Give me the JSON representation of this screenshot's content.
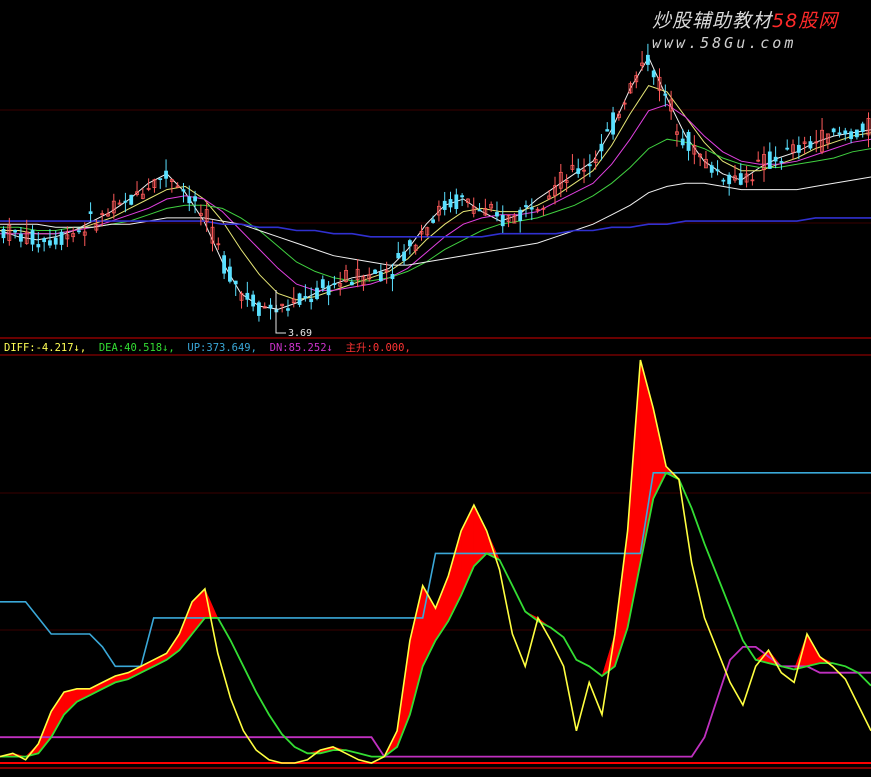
{
  "watermark": {
    "title_main": "炒股辅助教材",
    "title_brand": "58股网",
    "url": "www.58Gu.com"
  },
  "price_panel": {
    "min_label": "3.69"
  },
  "indicator_legend": [
    {
      "label": "DIFF:",
      "value": "-4.217",
      "arrow": "↓",
      "color": "#ffff55"
    },
    {
      "label": "DEA:",
      "value": "40.518",
      "arrow": "↓",
      "color": "#33dd33"
    },
    {
      "label": "UP:",
      "value": "373.649",
      "arrow": "",
      "color": "#3aa8d8"
    },
    {
      "label": "DN:",
      "value": "85.252",
      "arrow": "↓",
      "color": "#cc33cc"
    },
    {
      "label": "主升:",
      "value": "0.000",
      "arrow": "",
      "color": "#ff3333"
    }
  ],
  "colors": {
    "background": "#000000",
    "up_candle": "#ff5a5a",
    "down_candle": "#5ae0ff",
    "ma_white": "#f0f0f0",
    "ma_yellow": "#e6e676",
    "ma_magenta": "#e040e0",
    "ma_green": "#40d040",
    "ma_blue": "#3030d0",
    "diff": "#ffff40",
    "dea": "#33dd33",
    "up": "#3aa8d8",
    "dn": "#c030c0",
    "fill": "#ff0000",
    "separator": "#aa0000",
    "grid": "#3a0000"
  },
  "chart_data": [
    {
      "type": "line",
      "title": "",
      "annotations": [
        "3.69"
      ],
      "series": [
        {
          "values": [
            30,
            28,
            27,
            28,
            30,
            33,
            36,
            40,
            45,
            48,
            42,
            33,
            20,
            10,
            6,
            5,
            7,
            10,
            13,
            15,
            16,
            18,
            24,
            32,
            38,
            40,
            36,
            33,
            35,
            40,
            44,
            48,
            52,
            62,
            75,
            85,
            72,
            60,
            52,
            48,
            46,
            50,
            53,
            55,
            58,
            60,
            61,
            62
          ]
        },
        {
          "values": [
            30,
            30,
            29,
            29,
            30,
            32,
            34,
            37,
            40,
            43,
            44,
            40,
            33,
            24,
            16,
            10,
            8,
            9,
            11,
            13,
            15,
            17,
            21,
            27,
            32,
            36,
            37,
            36,
            36,
            38,
            41,
            45,
            49,
            57,
            67,
            76,
            74,
            66,
            58,
            52,
            49,
            49,
            51,
            53,
            56,
            58,
            60,
            61
          ]
        },
        {
          "values": [
            29,
            29,
            29,
            29,
            30,
            31,
            33,
            35,
            37,
            40,
            41,
            40,
            36,
            30,
            24,
            18,
            13,
            11,
            11,
            12,
            13,
            15,
            18,
            23,
            28,
            32,
            34,
            35,
            35,
            36,
            39,
            42,
            45,
            51,
            59,
            68,
            70,
            66,
            60,
            55,
            52,
            51,
            51,
            52,
            54,
            56,
            58,
            59
          ]
        },
        {
          "values": [
            31,
            31,
            30,
            30,
            31,
            31,
            32,
            33,
            35,
            37,
            38,
            38,
            37,
            34,
            30,
            25,
            20,
            17,
            15,
            14,
            14,
            15,
            17,
            20,
            24,
            27,
            30,
            32,
            33,
            34,
            36,
            38,
            41,
            45,
            50,
            56,
            59,
            58,
            56,
            53,
            51,
            50,
            50,
            51,
            52,
            53,
            55,
            56
          ]
        },
        {
          "values": [
            32,
            32,
            32,
            31,
            31,
            31,
            32,
            32,
            33,
            34,
            34,
            34,
            33,
            32,
            30,
            28,
            26,
            24,
            22,
            21,
            20,
            19,
            19,
            20,
            21,
            22,
            23,
            24,
            25,
            26,
            28,
            30,
            32,
            35,
            38,
            42,
            44,
            45,
            45,
            44,
            43,
            43,
            43,
            43,
            44,
            45,
            46,
            47
          ]
        },
        {
          "values": [
            33,
            33,
            33,
            33,
            33,
            33,
            33,
            33,
            33,
            33,
            33,
            33,
            32,
            32,
            31,
            31,
            30,
            30,
            29,
            29,
            28,
            28,
            28,
            28,
            28,
            28,
            28,
            29,
            29,
            29,
            29,
            30,
            30,
            31,
            31,
            32,
            32,
            33,
            33,
            33,
            33,
            33,
            33,
            33,
            34,
            34,
            34,
            34
          ]
        }
      ]
    },
    {
      "type": "area",
      "title": "",
      "series": [
        {
          "name": "DIFF",
          "values": [
            2,
            3,
            1,
            6,
            16,
            22,
            23,
            23,
            25,
            27,
            28,
            30,
            32,
            34,
            40,
            50,
            54,
            34,
            20,
            10,
            4,
            1,
            0,
            0,
            1,
            4,
            5,
            3,
            1,
            0,
            2,
            10,
            38,
            55,
            48,
            58,
            72,
            80,
            72,
            60,
            40,
            30,
            45,
            38,
            30,
            10,
            25,
            15,
            40,
            72,
            125,
            110,
            92,
            88,
            62,
            45,
            35,
            25,
            18,
            30,
            35,
            28,
            25,
            40,
            33,
            30,
            26,
            18,
            10
          ]
        },
        {
          "name": "DEA",
          "values": [
            2,
            2,
            2,
            3,
            8,
            15,
            19,
            21,
            23,
            25,
            26,
            28,
            30,
            32,
            35,
            40,
            45,
            45,
            38,
            30,
            22,
            15,
            9,
            5,
            3,
            3,
            4,
            4,
            3,
            2,
            2,
            5,
            15,
            30,
            38,
            44,
            52,
            61,
            65,
            63,
            55,
            47,
            44,
            42,
            39,
            32,
            30,
            27,
            30,
            42,
            62,
            82,
            90,
            88,
            79,
            68,
            58,
            48,
            38,
            32,
            31,
            30,
            29,
            30,
            31,
            31,
            30,
            28,
            24
          ]
        },
        {
          "name": "UP",
          "values": [
            50,
            50,
            50,
            45,
            40,
            40,
            40,
            40,
            36,
            30,
            30,
            30,
            45,
            45,
            45,
            45,
            45,
            45,
            45,
            45,
            45,
            45,
            45,
            45,
            45,
            45,
            45,
            45,
            45,
            45,
            45,
            45,
            45,
            45,
            65,
            65,
            65,
            65,
            65,
            65,
            65,
            65,
            65,
            65,
            65,
            65,
            65,
            65,
            65,
            65,
            65,
            90,
            90,
            90,
            90,
            90,
            90,
            90,
            90,
            90,
            90,
            90,
            90,
            90,
            90,
            90,
            90,
            90,
            90
          ]
        },
        {
          "name": "DN",
          "values": [
            8,
            8,
            8,
            8,
            8,
            8,
            8,
            8,
            8,
            8,
            8,
            8,
            8,
            8,
            8,
            8,
            8,
            8,
            8,
            8,
            8,
            8,
            8,
            8,
            8,
            8,
            8,
            8,
            8,
            8,
            2,
            2,
            2,
            2,
            2,
            2,
            2,
            2,
            2,
            2,
            2,
            2,
            2,
            2,
            2,
            2,
            2,
            2,
            2,
            2,
            2,
            2,
            2,
            2,
            2,
            8,
            20,
            32,
            36,
            36,
            33,
            30,
            30,
            30,
            28,
            28,
            28,
            28,
            28
          ]
        },
        {
          "name": "主升",
          "values": [
            0,
            0,
            0,
            0,
            0,
            0,
            0,
            0,
            0,
            0,
            0,
            0,
            0,
            0,
            0,
            0,
            0,
            0,
            0,
            0,
            0,
            0,
            0,
            0,
            0,
            0,
            0,
            0,
            0,
            0,
            0,
            0,
            0,
            0,
            0,
            0,
            0,
            0,
            0,
            0,
            0,
            0,
            0,
            0,
            0,
            0,
            0,
            0,
            0,
            0,
            0,
            0,
            0,
            0,
            0,
            0,
            0,
            0,
            0,
            0,
            0,
            0,
            0,
            0,
            0,
            0,
            0,
            0,
            0
          ]
        }
      ]
    }
  ]
}
